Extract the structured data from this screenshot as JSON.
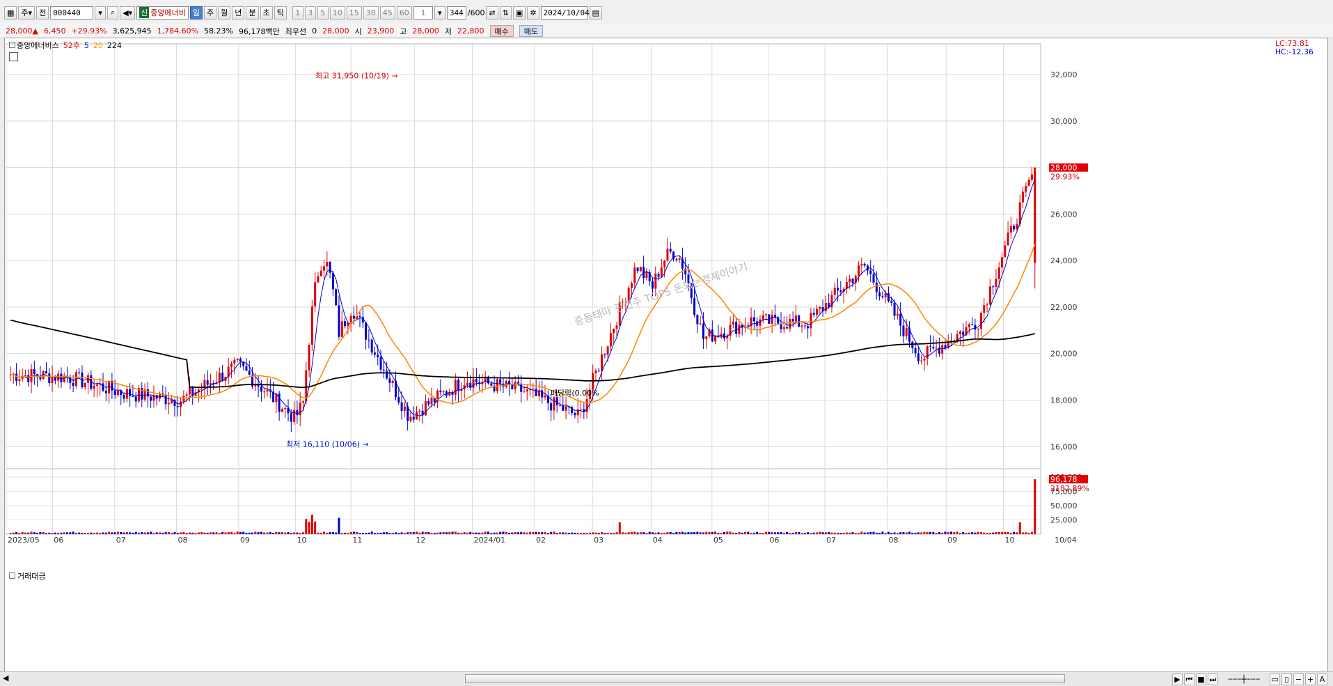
{
  "toolbar": {
    "mode_main": "주",
    "mode_prev": "전",
    "code": "000440",
    "stock_tag": "신",
    "stock_name": "중앙에너비",
    "periods": [
      "일",
      "주",
      "월",
      "년",
      "분",
      "초",
      "틱"
    ],
    "active_period": "일",
    "intervals": [
      "1",
      "3",
      "5",
      "10",
      "15",
      "30",
      "45",
      "60"
    ],
    "multiplier": "1",
    "count": "344",
    "count_total": "/600",
    "date": "2024/10/04"
  },
  "quote": {
    "price": "28,000",
    "change": "6,450",
    "change_pct": "+29.93%",
    "volume": "3,625,945",
    "volume_pct": "1,784.60%",
    "turnover": "58.23%",
    "amount": "96,178백만",
    "priority_label": "최우선",
    "priority_val": "0",
    "ask": "28,000",
    "open_label": "시",
    "open": "23,900",
    "high_label": "고",
    "high": "28,000",
    "low_label": "저",
    "low": "22,800",
    "buy": "매수",
    "sell": "매도"
  },
  "legend": {
    "name": "중앙에너비스",
    "ma_labels": [
      "52주",
      "5",
      "20",
      "224"
    ]
  },
  "lchc": {
    "lc": "LC:73.81",
    "hc": "HC:-12.36"
  },
  "price_axis": [
    "32,000",
    "30,000",
    "28,000",
    "26,000",
    "24,000",
    "22,000",
    "20,000",
    "18,000",
    "16,000"
  ],
  "current_tag": {
    "price": "28,000",
    "pct": "29.93%"
  },
  "volume_axis": [
    "100,000",
    "75,000",
    "50,000",
    "25,000"
  ],
  "vol_tag": {
    "value": "96,178",
    "pct": "2182.89%"
  },
  "vol_label": "거래대금",
  "time_axis": [
    "2023/05",
    "06",
    "07",
    "08",
    "09",
    "10",
    "11",
    "12",
    "2024/01",
    "02",
    "03",
    "04",
    "05",
    "06",
    "07",
    "08",
    "09",
    "10",
    "10/04"
  ],
  "annotations": {
    "high": "최고 31,950 (10/19)",
    "low": "최저 16,110 (10/06)",
    "dividend": "배당락(0.00%"
  },
  "watermark": "중동테마 관련주 TOP5 돈되는경제이야기",
  "colors": {
    "up": "#e00000",
    "down": "#0000d0",
    "ma5": "#0000d0",
    "ma20": "#ff8c00",
    "ma224": "#000000"
  },
  "chart_data": {
    "type": "candlestick",
    "price_ylim": [
      15200,
      32900
    ],
    "volume_ylim": [
      0,
      100000
    ],
    "monthly_close": [
      [
        "2023/05",
        19100
      ],
      [
        "06",
        19000
      ],
      [
        "07",
        18300
      ],
      [
        "08",
        18000
      ],
      [
        "09",
        19500
      ],
      [
        "10",
        17200
      ],
      [
        "11",
        22000
      ],
      [
        "12",
        17300
      ],
      [
        "2024/01",
        18900
      ],
      [
        "02",
        18400
      ],
      [
        "03",
        17300
      ],
      [
        "04",
        23800
      ],
      [
        "05",
        20500
      ],
      [
        "06",
        21400
      ],
      [
        "07",
        21300
      ],
      [
        "08",
        23800
      ],
      [
        "09",
        19800
      ],
      [
        "10",
        21400
      ],
      [
        "10/04",
        28000
      ]
    ],
    "last_volume": 96178
  }
}
